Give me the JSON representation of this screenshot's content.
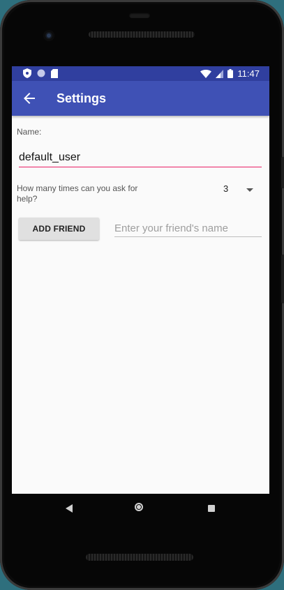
{
  "statusbar": {
    "time": "11:47",
    "icons_left": [
      "shield-icon",
      "circle-icon",
      "sd-card-icon"
    ],
    "icons_right": [
      "wifi-icon",
      "signal-icon",
      "battery-icon"
    ]
  },
  "appbar": {
    "title": "Settings",
    "back_icon": "arrow-back-icon"
  },
  "form": {
    "name_label": "Name:",
    "name_value": "default_user",
    "help_label": "How many times can you ask for help?",
    "help_count": "3",
    "add_friend_label": "ADD FRIEND",
    "friend_placeholder": "Enter your friend's name",
    "friend_value": ""
  },
  "navbar": {
    "icons": [
      "nav-back-icon",
      "nav-home-icon",
      "nav-recent-icon"
    ]
  },
  "colors": {
    "statusbar": "#303f9f",
    "appbar": "#3f51b5",
    "accent_underline": "#e91e63",
    "button_bg": "#e0e0e0"
  }
}
